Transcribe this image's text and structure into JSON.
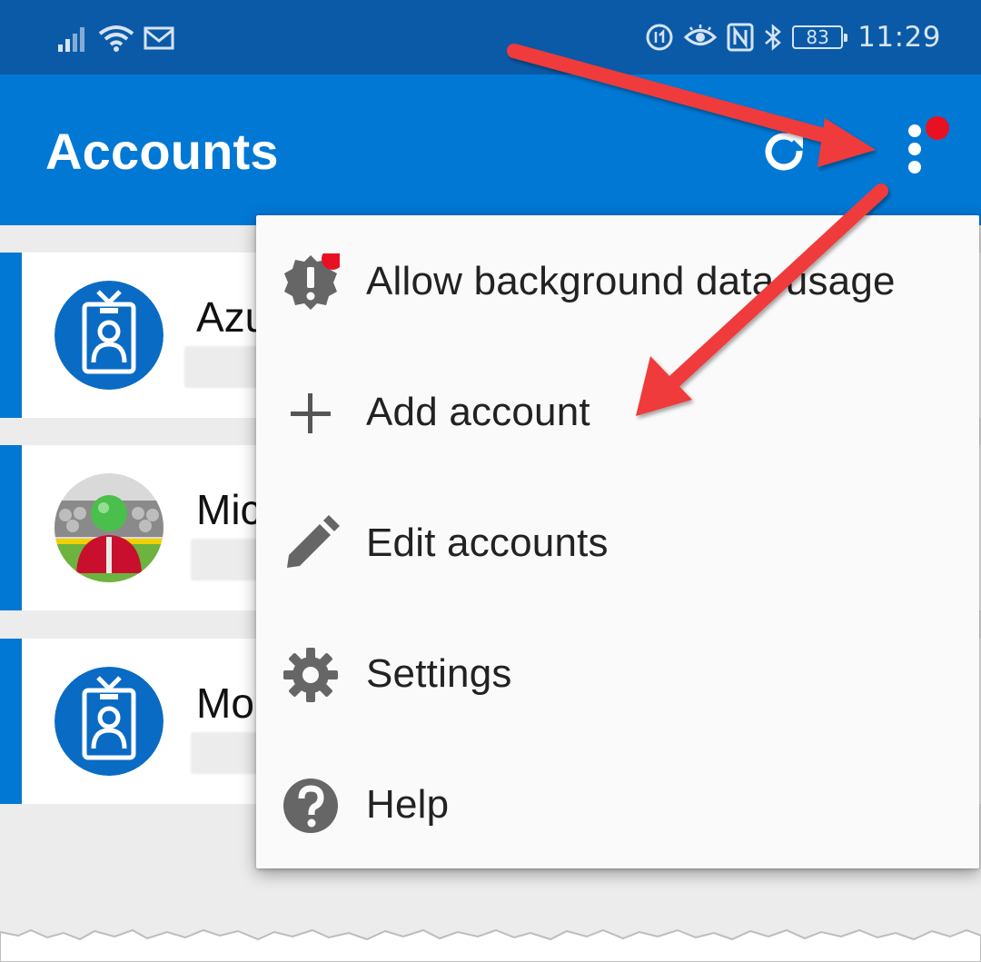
{
  "status_bar": {
    "battery_level": "83",
    "time": "11:29"
  },
  "app_bar": {
    "title": "Accounts"
  },
  "accounts": [
    {
      "name": "Azu",
      "avatar": "id-badge-icon"
    },
    {
      "name": "Mic",
      "avatar": "person-avatar-photo"
    },
    {
      "name": "Mo",
      "avatar": "id-badge-icon"
    }
  ],
  "menu": {
    "items": [
      {
        "label": "Allow background data usage",
        "icon": "alert-badge-icon"
      },
      {
        "label": "Add account",
        "icon": "plus-icon"
      },
      {
        "label": "Edit accounts",
        "icon": "pencil-icon"
      },
      {
        "label": "Settings",
        "icon": "gear-icon"
      },
      {
        "label": "Help",
        "icon": "help-icon"
      }
    ]
  },
  "colors": {
    "status_bar": "#0b5aa8",
    "app_bar": "#0078d4",
    "accent": "#0078d4",
    "badge": "#e81123",
    "annotation_arrow": "#ef3b3b"
  }
}
